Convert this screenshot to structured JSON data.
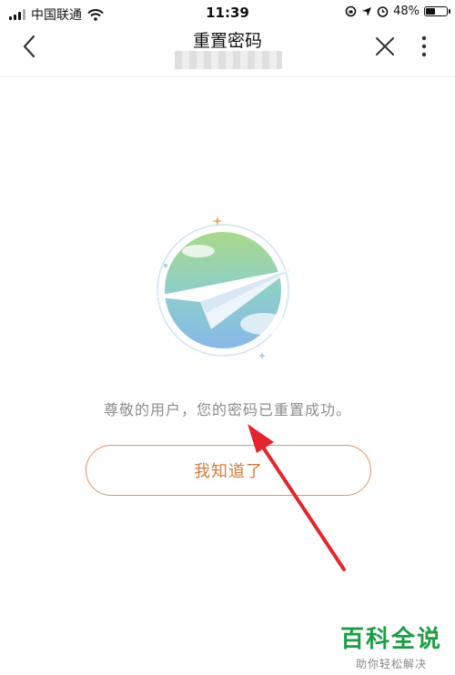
{
  "status_bar": {
    "carrier": "中国联通",
    "time": "11:39",
    "battery_percent": "48%",
    "battery_level": 0.48,
    "icons": [
      "signal-icon",
      "wifi-icon",
      "rotation-lock-icon",
      "location-icon",
      "alarm-icon",
      "battery-icon"
    ]
  },
  "nav": {
    "title": "重置密码",
    "icons": [
      "back-icon",
      "close-icon",
      "more-icon"
    ]
  },
  "content": {
    "message": "尊敬的用户，您的密码已重置成功。",
    "button_label": "我知道了",
    "illustration": "paper-plane-illustration"
  },
  "colors": {
    "button_text": "#d47c3f",
    "button_border": "#d9956a",
    "annotation_arrow": "#e5242d",
    "watermark": "#1c9e45"
  },
  "watermark": {
    "title": "百科全说",
    "subtitle": "助你轻松解决"
  }
}
